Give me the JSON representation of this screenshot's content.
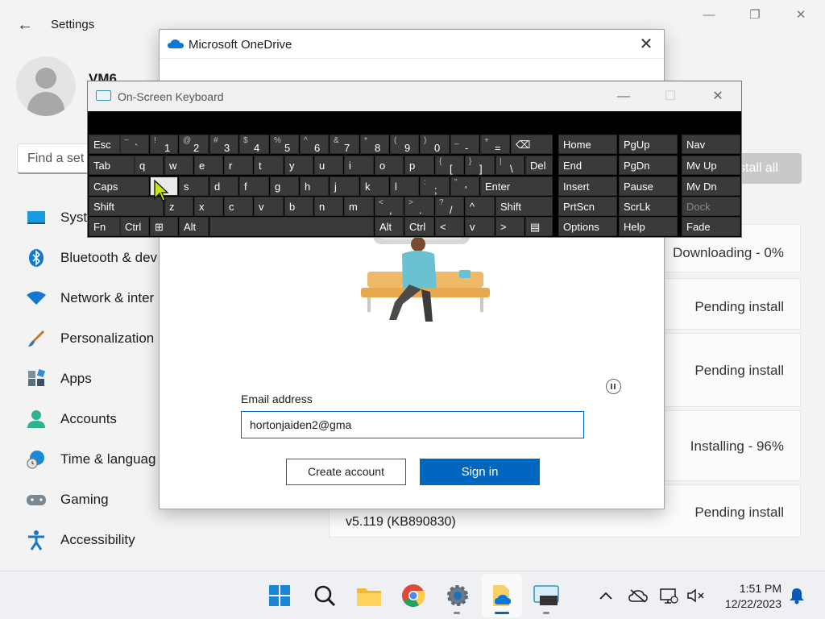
{
  "settings": {
    "title": "Settings",
    "user_name": "VM6",
    "search_placeholder": "Find a set",
    "install_all": "stall all",
    "nav": [
      {
        "label": "Syste",
        "icon": "system-icon"
      },
      {
        "label": "Bluetooth & dev",
        "icon": "bluetooth-icon"
      },
      {
        "label": "Network & inter",
        "icon": "wifi-icon"
      },
      {
        "label": "Personalization",
        "icon": "brush-icon"
      },
      {
        "label": "Apps",
        "icon": "apps-icon"
      },
      {
        "label": "Accounts",
        "icon": "person-icon"
      },
      {
        "label": "Time & languag",
        "icon": "globe-clock-icon"
      },
      {
        "label": "Gaming",
        "icon": "controller-icon"
      },
      {
        "label": "Accessibility",
        "icon": "accessibility-icon"
      }
    ],
    "updates": [
      {
        "status": "Downloading - 0%",
        "name": ""
      },
      {
        "status": "Pending install",
        "name": ""
      },
      {
        "status": "Pending install",
        "name": ""
      },
      {
        "status": "Installing - 96%",
        "name": ""
      },
      {
        "status": "Pending install",
        "name": "v5.119 (KB890830)"
      }
    ]
  },
  "onedrive": {
    "title": "Microsoft OneDrive",
    "email_label": "Email address",
    "email_value": "hortonjaiden2@gma",
    "create_account": "Create account",
    "sign_in": "Sign in"
  },
  "osk": {
    "title": "On-Screen Keyboard",
    "rows": [
      [
        [
          "Esc"
        ],
        [
          "~",
          "`"
        ],
        [
          "!",
          "1"
        ],
        [
          "@",
          "2"
        ],
        [
          "#",
          "3"
        ],
        [
          "$",
          "4"
        ],
        [
          "%",
          "5"
        ],
        [
          "^",
          "6"
        ],
        [
          "&",
          "7"
        ],
        [
          "*",
          "8"
        ],
        [
          "(",
          "9"
        ],
        [
          ")",
          "0"
        ],
        [
          "_",
          "-"
        ],
        [
          "+",
          "="
        ],
        [
          "⌫"
        ]
      ],
      [
        [
          "Tab"
        ],
        [
          "q"
        ],
        [
          "w"
        ],
        [
          "e"
        ],
        [
          "r"
        ],
        [
          "t"
        ],
        [
          "y"
        ],
        [
          "u"
        ],
        [
          "i"
        ],
        [
          "o"
        ],
        [
          "p"
        ],
        [
          "{",
          "["
        ],
        [
          "}",
          "]"
        ],
        [
          "|",
          "\\"
        ],
        [
          "Del"
        ]
      ],
      [
        [
          "Caps"
        ],
        [
          ""
        ],
        [
          "s"
        ],
        [
          "d"
        ],
        [
          "f"
        ],
        [
          "g"
        ],
        [
          "h"
        ],
        [
          "j"
        ],
        [
          "k"
        ],
        [
          "l"
        ],
        [
          ":",
          ";"
        ],
        [
          "\"",
          "'"
        ],
        [
          "Enter"
        ]
      ],
      [
        [
          "Shift"
        ],
        [
          "z"
        ],
        [
          "x"
        ],
        [
          "c"
        ],
        [
          "v"
        ],
        [
          "b"
        ],
        [
          "n"
        ],
        [
          "m"
        ],
        [
          "<",
          ","
        ],
        [
          ">",
          "."
        ],
        [
          "?",
          "/"
        ],
        [
          "^"
        ],
        [
          "Shift"
        ]
      ],
      [
        [
          "Fn"
        ],
        [
          "Ctrl"
        ],
        [
          "⊞"
        ],
        [
          "Alt"
        ],
        [
          ""
        ],
        [
          "Alt"
        ],
        [
          "Ctrl"
        ],
        [
          "<"
        ],
        [
          "v"
        ],
        [
          ">"
        ],
        [
          "▤"
        ]
      ]
    ],
    "nav_keys": [
      [
        "Home",
        "PgUp",
        "Nav"
      ],
      [
        "End",
        "PgDn",
        "Mv Up"
      ],
      [
        "Insert",
        "Pause",
        "Mv Dn"
      ],
      [
        "PrtScn",
        "ScrLk",
        "Dock"
      ],
      [
        "Options",
        "Help",
        "Fade"
      ]
    ]
  },
  "taskbar": {
    "time": "1:51 PM",
    "date": "12/22/2023"
  }
}
